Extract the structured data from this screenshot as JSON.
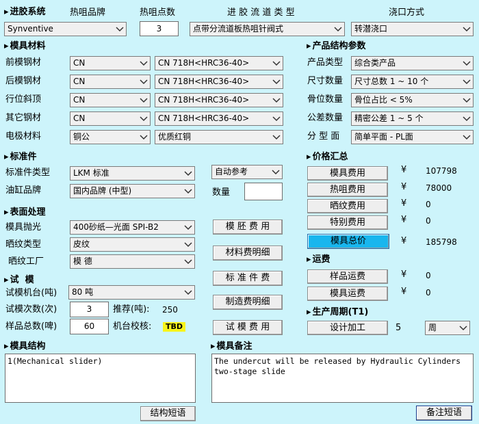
{
  "injection": {
    "section_title": "进胶系统",
    "brand_label": "热咀品牌",
    "points_label": "热咀点数",
    "runner_type_label": "进 胶 流 道 类 型",
    "gate_label": "浇口方式",
    "brand_value": "Synventive",
    "points_value": "3",
    "runner_type_value": "点带分流道板热咀针阀式",
    "gate_value": "转潜浇口"
  },
  "materials": {
    "section_title": "模具材料",
    "rows": [
      {
        "label": "前模钢材",
        "origin": "CN",
        "grade": "CN 718H<HRC36-40>"
      },
      {
        "label": "后模钢材",
        "origin": "CN",
        "grade": "CN 718H<HRC36-40>"
      },
      {
        "label": "行位斜顶",
        "origin": "CN",
        "grade": "CN 718H<HRC36-40>"
      },
      {
        "label": "其它钢材",
        "origin": "CN",
        "grade": "CN 718H<HRC36-40>"
      },
      {
        "label": "电极材料",
        "origin": "铜公",
        "grade": "优质红铜"
      }
    ]
  },
  "product": {
    "section_title": "产品结构参数",
    "rows": [
      {
        "label": "产品类型",
        "value": "综合类产品"
      },
      {
        "label": "尺寸数量",
        "value": "尺寸总数 1 ~ 10 个"
      },
      {
        "label": "骨位数量",
        "value": "骨位占比  < 5%"
      },
      {
        "label": "公差数量",
        "value": "精密公差 1 ~ 5 个"
      },
      {
        "label": "分 型 面",
        "value": "简单平面 - PL面"
      }
    ]
  },
  "standard": {
    "section_title": "标准件",
    "type_label": "标准件类型",
    "type_value": "LKM 标准",
    "auto_value": "自动参考",
    "cylinder_label": "油缸品牌",
    "cylinder_value": "国内品牌 (中型)",
    "qty_label": "数量",
    "qty_value": ""
  },
  "surface": {
    "section_title": "表面处理",
    "polish_label": "模具抛光",
    "polish_value": "400砂纸—光面 SPI-B2",
    "texture_label": "晒纹类型",
    "texture_value": "皮纹",
    "factory_label": "晒纹工厂",
    "factory_value": "模 德"
  },
  "trial": {
    "section_title": "试  模",
    "machine_label": "试模机台(吨)",
    "machine_value": "80 吨",
    "times_label": "试模次数(次)",
    "times_value": "3",
    "recommend_label": "推荐(吨):",
    "recommend_value": "250",
    "samples_label": "样品总数(啤)",
    "samples_value": "60",
    "check_label": "机台校核:",
    "check_value": "TBD"
  },
  "middle_buttons": {
    "blank_cost": "模 胚 费 用",
    "material_detail": "材料费明细",
    "standard_cost": "标 准 件 费",
    "manufacture_detail": "制造费明细",
    "trial_cost": "试 模 费 用"
  },
  "price": {
    "section_title": "价格汇总",
    "currency": "¥",
    "rows": [
      {
        "label": "模具费用",
        "value": "107798"
      },
      {
        "label": "热咀费用",
        "value": "78000"
      },
      {
        "label": "晒纹费用",
        "value": "0"
      },
      {
        "label": "特别费用",
        "value": "0"
      }
    ],
    "total_label": "模具总价",
    "total_value": "185798",
    "total_color": "#19b6ee"
  },
  "freight": {
    "section_title": "运费",
    "rows": [
      {
        "label": "样品运费",
        "value": "0"
      },
      {
        "label": "模具运费",
        "value": "0"
      }
    ]
  },
  "cycle": {
    "section_title": "生产周期(T1)",
    "design_label": "设计加工",
    "design_value": "5",
    "unit_value": "周"
  },
  "structure": {
    "section_title": "模具结构",
    "text": "1(Mechanical slider)",
    "button": "结构短语"
  },
  "remarks": {
    "section_title": "模具备注",
    "text": "The undercut will be released by Hydraulic Cylinders\ntwo-stage slide",
    "button": "备注短语"
  }
}
